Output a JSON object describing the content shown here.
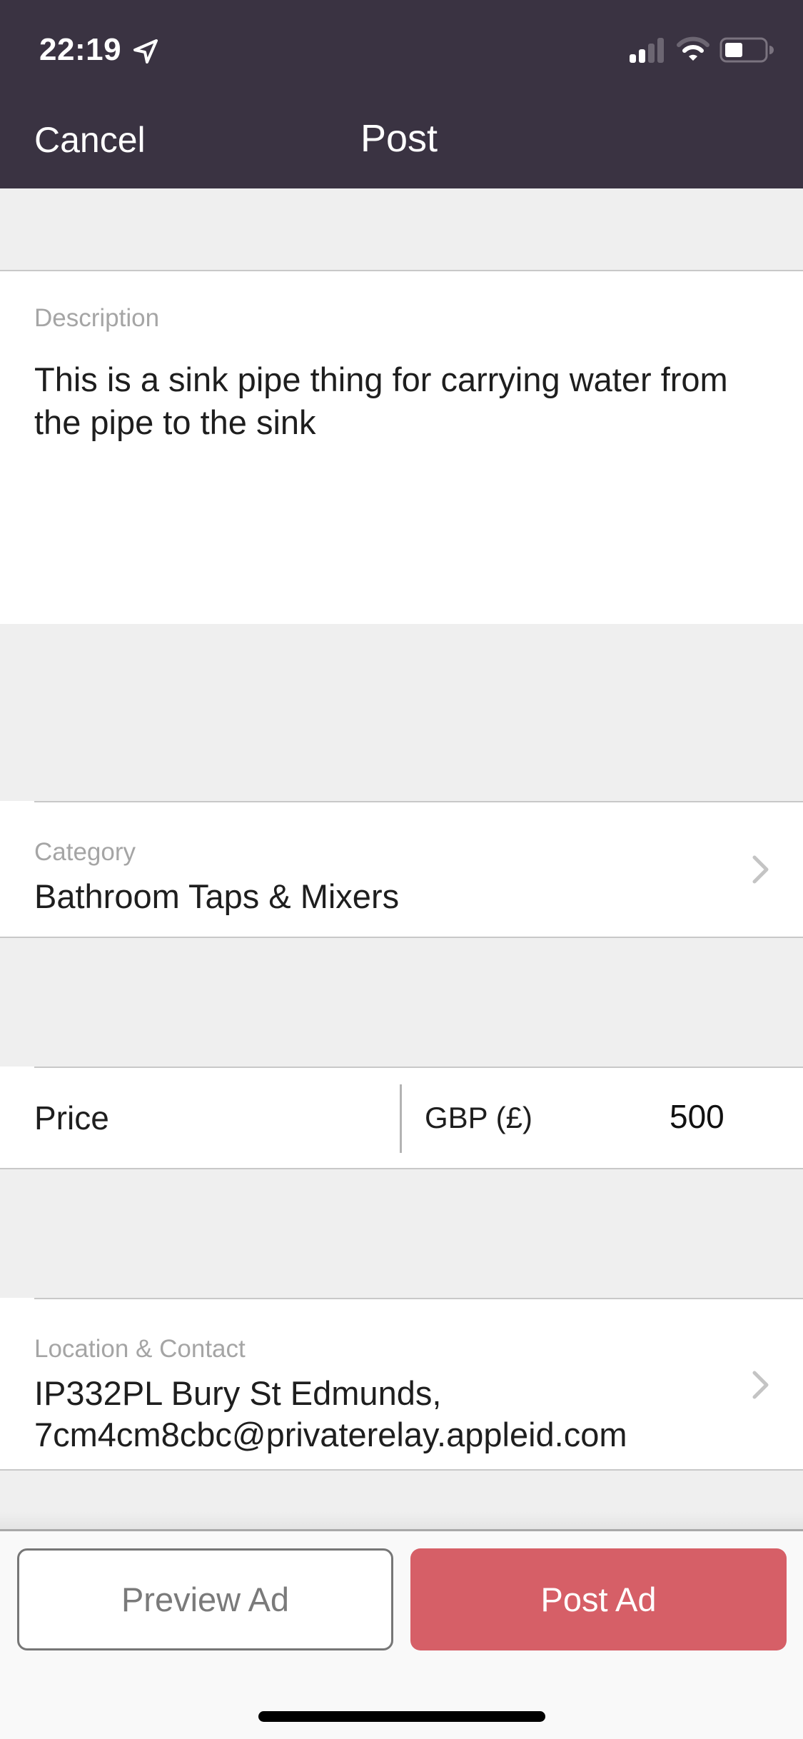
{
  "status_bar": {
    "time": "22:19",
    "location_icon": "location-arrow-icon",
    "signal_bars_active": 2,
    "signal_bars_total": 4,
    "wifi_strength": "2/3",
    "battery_level_percent": 40
  },
  "nav": {
    "cancel_label": "Cancel",
    "title": "Post"
  },
  "form": {
    "description": {
      "label": "Description",
      "value": "This is a sink pipe thing for carrying water from the pipe to the sink"
    },
    "category": {
      "label": "Category",
      "value": "Bathroom Taps & Mixers",
      "icon": "chevron-right-icon"
    },
    "price": {
      "label": "Price",
      "currency": "GBP (£)",
      "value": "500"
    },
    "location_contact": {
      "label": "Location & Contact",
      "line1": "IP332PL Bury St Edmunds,",
      "line2": "7cm4cm8cbc@privaterelay.appleid.com",
      "icon": "chevron-right-icon"
    }
  },
  "actions": {
    "preview_label": "Preview Ad",
    "post_label": "Post Ad"
  },
  "colors": {
    "header_bg": "#3a3342",
    "accent": "#d65f67",
    "page_bg": "#efefef",
    "label_gray": "#a5a5a5"
  }
}
